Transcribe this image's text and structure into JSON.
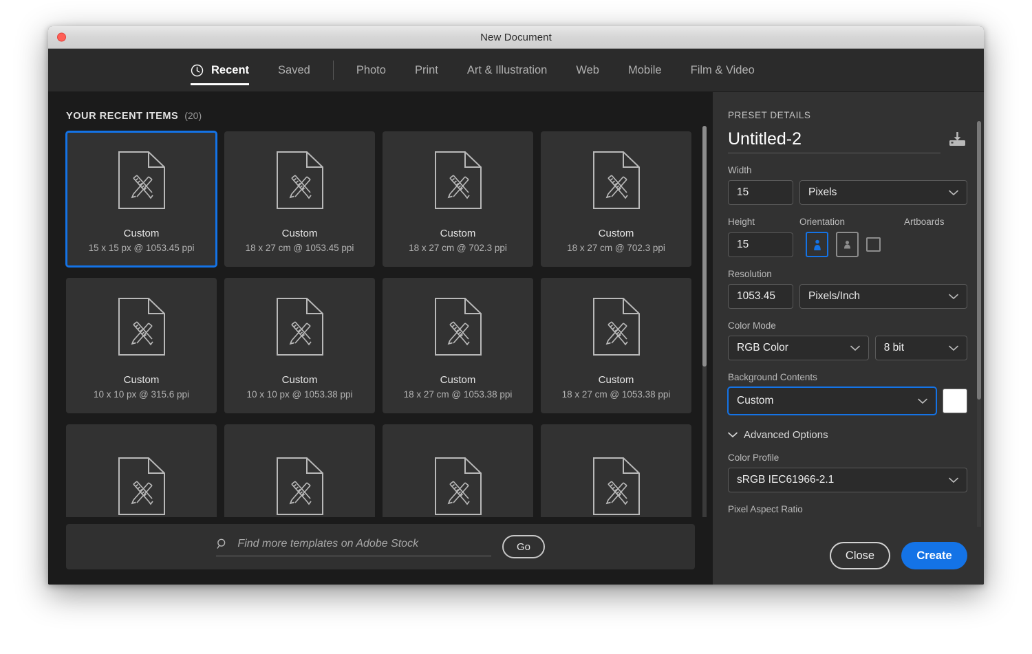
{
  "window": {
    "title": "New Document",
    "close_tooltip": "Close"
  },
  "tabs": [
    {
      "label": "Recent",
      "icon": "clock-icon",
      "active": true
    },
    {
      "label": "Saved",
      "active": false
    },
    {
      "label": "Photo",
      "active": false
    },
    {
      "label": "Print",
      "active": false
    },
    {
      "label": "Art & Illustration",
      "active": false
    },
    {
      "label": "Web",
      "active": false
    },
    {
      "label": "Mobile",
      "active": false
    },
    {
      "label": "Film & Video",
      "active": false
    }
  ],
  "recent": {
    "header": "YOUR RECENT ITEMS",
    "count": "(20)",
    "items": [
      {
        "title": "Custom",
        "sub": "15 x 15 px @ 1053.45 ppi",
        "selected": true
      },
      {
        "title": "Custom",
        "sub": "18 x 27 cm @ 1053.45 ppi",
        "selected": false
      },
      {
        "title": "Custom",
        "sub": "18 x 27 cm @ 702.3 ppi",
        "selected": false
      },
      {
        "title": "Custom",
        "sub": "18 x 27 cm @ 702.3 ppi",
        "selected": false
      },
      {
        "title": "Custom",
        "sub": "10 x 10 px @ 315.6 ppi",
        "selected": false
      },
      {
        "title": "Custom",
        "sub": "10 x 10 px @ 1053.38 ppi",
        "selected": false
      },
      {
        "title": "Custom",
        "sub": "18 x 27 cm @ 1053.38 ppi",
        "selected": false
      },
      {
        "title": "Custom",
        "sub": "18 x 27 cm @ 1053.38 ppi",
        "selected": false
      },
      {
        "title": "",
        "sub": "",
        "selected": false
      },
      {
        "title": "",
        "sub": "",
        "selected": false
      },
      {
        "title": "",
        "sub": "",
        "selected": false
      },
      {
        "title": "",
        "sub": "",
        "selected": false
      }
    ]
  },
  "stock": {
    "placeholder": "Find more templates on Adobe Stock",
    "value": "",
    "go_label": "Go",
    "search_icon": "search-icon"
  },
  "preset": {
    "section_title": "PRESET DETAILS",
    "document_name": "Untitled-2",
    "save_preset_icon": "save-preset-icon",
    "width_label": "Width",
    "width_value": "15",
    "width_unit": "Pixels",
    "height_label": "Height",
    "height_value": "15",
    "orientation_label": "Orientation",
    "orientation_portrait": "portrait-icon",
    "orientation_landscape": "landscape-icon",
    "artboards_label": "Artboards",
    "artboards_checked": false,
    "resolution_label": "Resolution",
    "resolution_value": "1053.45",
    "resolution_unit": "Pixels/Inch",
    "color_mode_label": "Color Mode",
    "color_mode_value": "RGB Color",
    "bit_depth_value": "8 bit",
    "background_label": "Background Contents",
    "background_value": "Custom",
    "background_swatch": "#ffffff",
    "advanced_label": "Advanced Options",
    "color_profile_label": "Color Profile",
    "color_profile_value": "sRGB IEC61966-2.1",
    "pixel_aspect_label": "Pixel Aspect Ratio"
  },
  "actions": {
    "close_label": "Close",
    "create_label": "Create"
  },
  "colors": {
    "accent": "#1473e6",
    "panel_bg": "#323232",
    "content_bg": "#1b1b1b",
    "tabbar_bg": "#2b2b2b",
    "card_bg": "#323232"
  }
}
